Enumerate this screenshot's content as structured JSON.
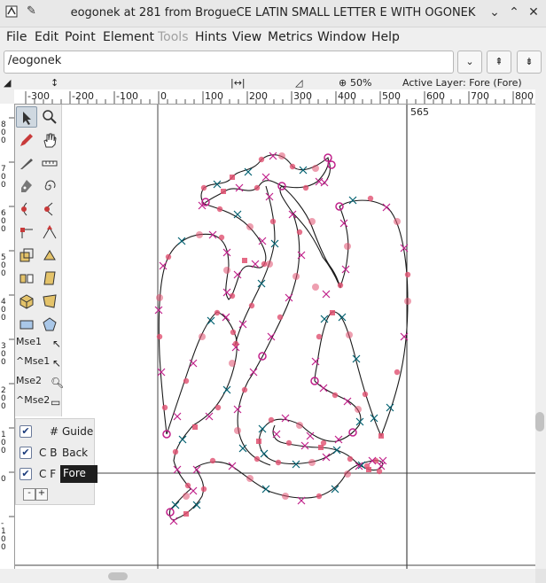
{
  "window": {
    "title": "eogonek at 281 from BrogueCE LATIN SMALL LETTER E WITH OGONEK",
    "minimize_glyph": "⌄",
    "maximize_glyph": "⌃",
    "close_glyph": "✕"
  },
  "menu": {
    "file": "File",
    "edit": "Edit",
    "point": "Point",
    "element": "Element",
    "tools": "Tools",
    "hints": "Hints",
    "view": "View",
    "metrics": "Metrics",
    "window": "Window",
    "help": "Help"
  },
  "glyph_name": {
    "value": "/eogonek"
  },
  "nav_buttons": {
    "dropdown": "⌄",
    "prev": "⇞",
    "next": "⇟"
  },
  "info": {
    "zoom": "50%",
    "active_layer": "Active Layer: Fore (Fore)"
  },
  "hruler": {
    "labels": [
      "-300",
      "-200",
      "-100",
      "0",
      "100",
      "200",
      "300",
      "400",
      "500",
      "600",
      "700",
      "800"
    ]
  },
  "vruler": {
    "labels": [
      "800",
      "700",
      "600",
      "500",
      "400",
      "300",
      "200",
      "100",
      "0",
      "-100"
    ]
  },
  "canvas": {
    "width_label": "565"
  },
  "tools": {
    "mse1": "Mse1",
    "ctrl_mse1": "^Mse1",
    "mse2": "Mse2",
    "ctrl_mse2": "^Mse2"
  },
  "layers": {
    "guide": {
      "flags": "#",
      "name": "Guide"
    },
    "back": {
      "flags": "C B",
      "name": "Back"
    },
    "fore": {
      "flags": "C F",
      "name": "Fore"
    },
    "minus": "-",
    "plus": "+"
  },
  "colors": {
    "accent": "#c0208a",
    "outline": "#1a1a1a",
    "node": "#e05070",
    "handle": "#006070"
  }
}
